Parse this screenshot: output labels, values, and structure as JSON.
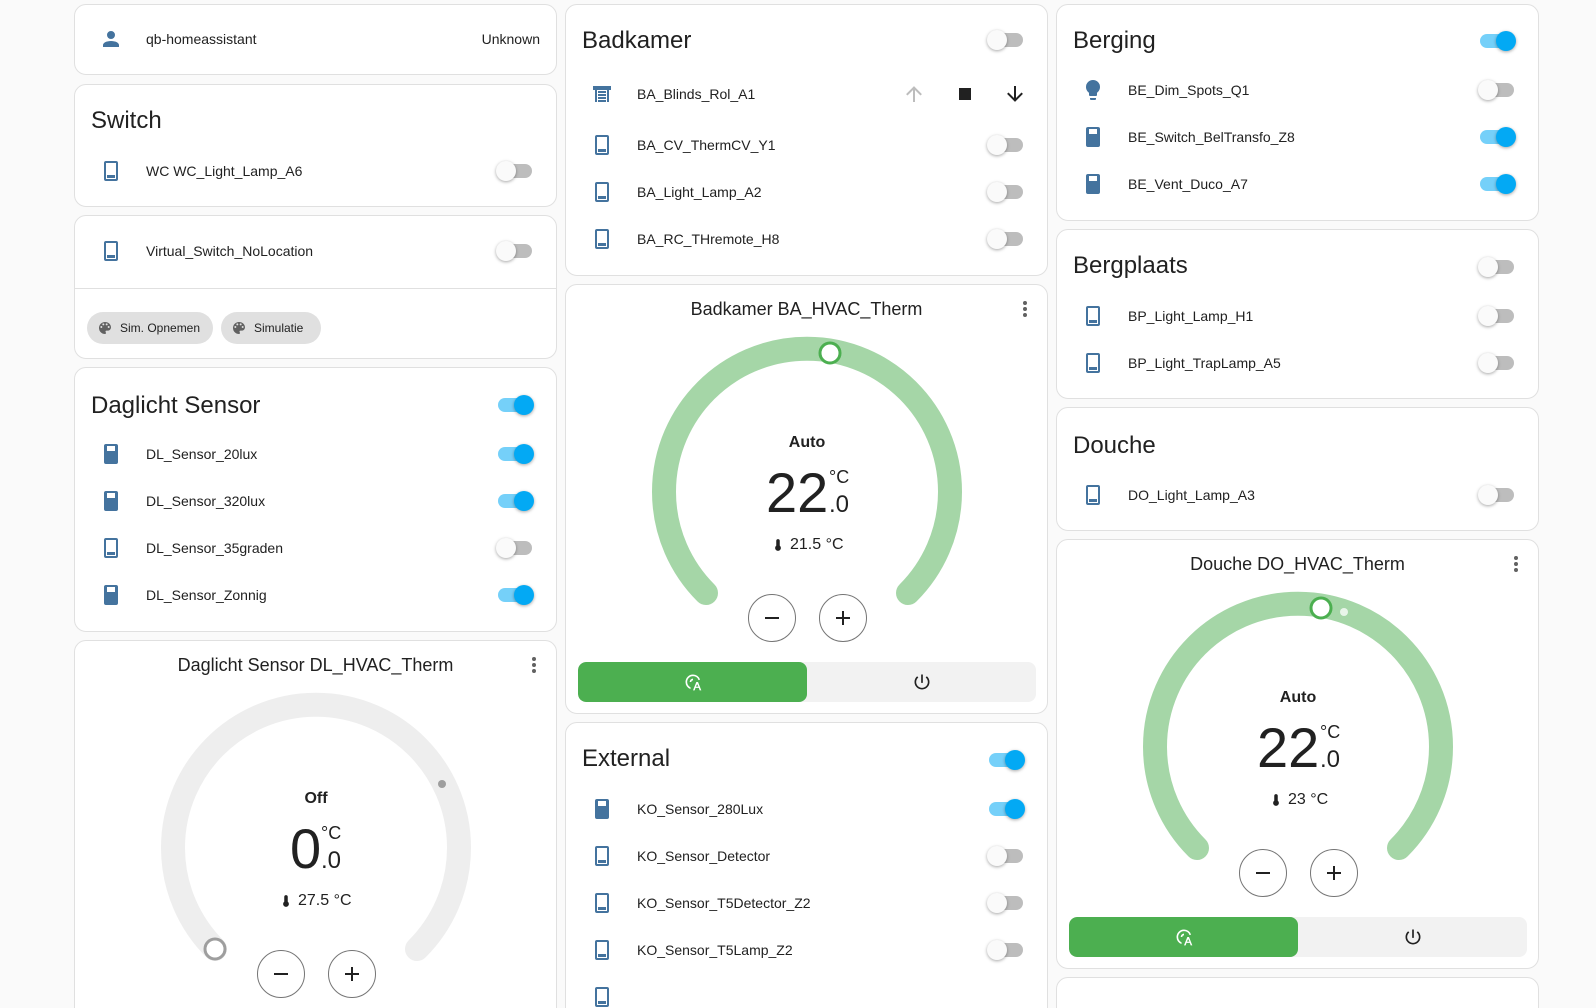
{
  "person_card": {
    "name": "qb-homeassistant",
    "state": "Unknown",
    "icon": "account-icon"
  },
  "switch_card": {
    "title": "Switch",
    "items": [
      {
        "label": "WC WC_Light_Lamp_A6",
        "on": false
      }
    ]
  },
  "virtual_card": {
    "items": [
      {
        "label": "Virtual_Switch_NoLocation",
        "on": false
      }
    ],
    "chips": [
      {
        "label": "Sim. Opnemen",
        "icon": "palette-icon"
      },
      {
        "label": "Simulatie",
        "icon": "palette-icon"
      }
    ]
  },
  "daglicht_card": {
    "title": "Daglicht Sensor",
    "on": true,
    "items": [
      {
        "label": "DL_Sensor_20lux",
        "on": true
      },
      {
        "label": "DL_Sensor_320lux",
        "on": true
      },
      {
        "label": "DL_Sensor_35graden",
        "on": false
      },
      {
        "label": "DL_Sensor_Zonnig",
        "on": true
      }
    ]
  },
  "daglicht_thermostat": {
    "name": "Daglicht Sensor DL_HVAC_Therm",
    "mode": "Off",
    "target_int": "0",
    "target_dec": ".0",
    "unit": "°C",
    "current": "27.5 °C"
  },
  "badkamer_card": {
    "title": "Badkamer",
    "on": false,
    "cover": {
      "label": "BA_Blinds_Rol_A1",
      "icon": "blinds-icon"
    },
    "items": [
      {
        "label": "BA_CV_ThermCV_Y1",
        "on": false
      },
      {
        "label": "BA_Light_Lamp_A2",
        "on": false
      },
      {
        "label": "BA_RC_THremote_H8",
        "on": false
      }
    ]
  },
  "badkamer_thermostat": {
    "name": "Badkamer BA_HVAC_Therm",
    "mode": "Auto",
    "target_int": "22",
    "target_dec": ".0",
    "unit": "°C",
    "current": "21.5 °C"
  },
  "external_card": {
    "title": "External",
    "on": true,
    "items": [
      {
        "label": "KO_Sensor_280Lux",
        "on": true
      },
      {
        "label": "KO_Sensor_Detector",
        "on": false
      },
      {
        "label": "KO_Sensor_T5Detector_Z2",
        "on": false
      },
      {
        "label": "KO_Sensor_T5Lamp_Z2",
        "on": false
      }
    ]
  },
  "berging_card": {
    "title": "Berging",
    "on": true,
    "items": [
      {
        "label": "BE_Dim_Spots_Q1",
        "on": false,
        "icon": "lightbulb-icon"
      },
      {
        "label": "BE_Switch_BelTransfo_Z8",
        "on": true,
        "icon": "switch-icon"
      },
      {
        "label": "BE_Vent_Duco_A7",
        "on": true,
        "icon": "switch-icon"
      }
    ]
  },
  "bergplaats_card": {
    "title": "Bergplaats",
    "on": false,
    "items": [
      {
        "label": "BP_Light_Lamp_H1",
        "on": false
      },
      {
        "label": "BP_Light_TrapLamp_A5",
        "on": false
      }
    ]
  },
  "douche_card": {
    "title": "Douche",
    "items": [
      {
        "label": "DO_Light_Lamp_A3",
        "on": false
      }
    ]
  },
  "douche_thermostat": {
    "name": "Douche DO_HVAC_Therm",
    "mode": "Auto",
    "target_int": "22",
    "target_dec": ".0",
    "unit": "°C",
    "current": "23 °C"
  },
  "colors": {
    "toggle_on": "#03a9f4",
    "switch_icon": "#44739e",
    "heat_arc": "#a5d6a7",
    "mode_active": "#4caf50"
  }
}
